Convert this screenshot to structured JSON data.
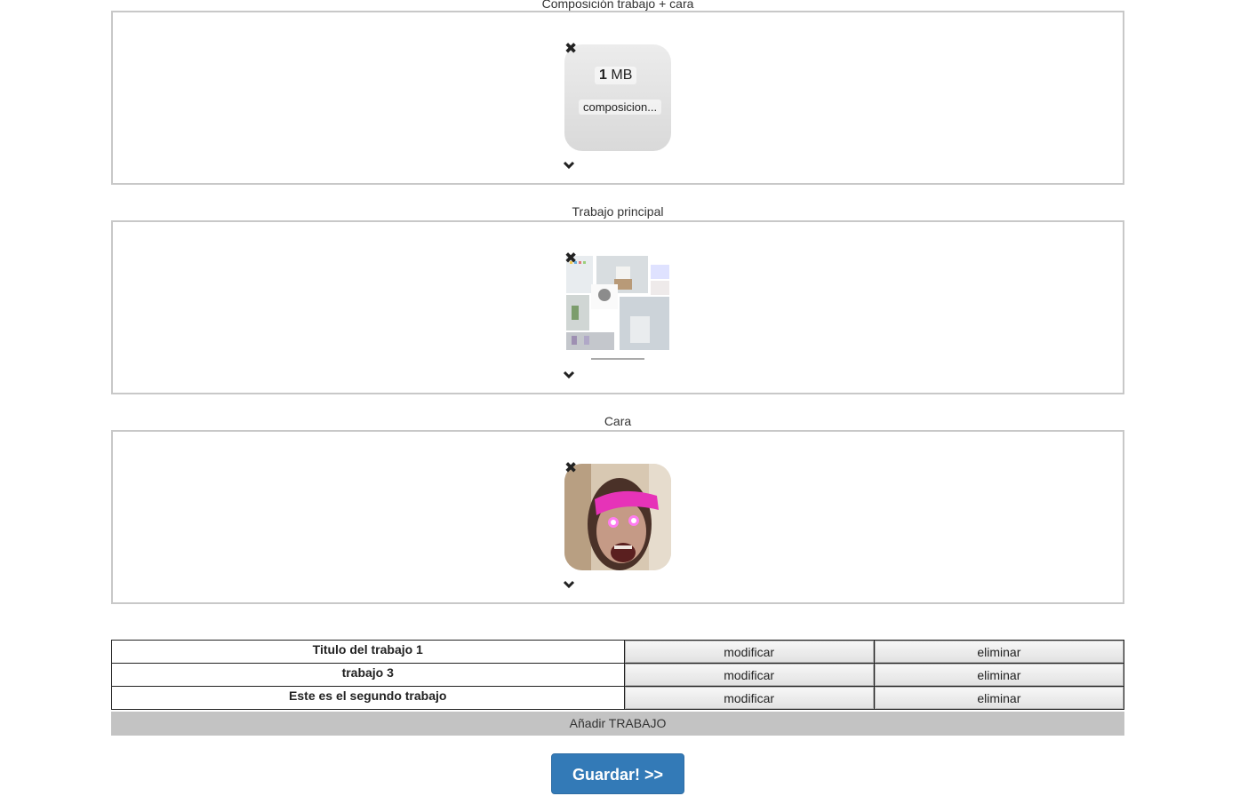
{
  "sections": [
    {
      "label": "Composición trabajo + cara",
      "file_size_value": "1",
      "file_size_unit": "MB",
      "file_name": "composicion..."
    },
    {
      "label": "Trabajo principal"
    },
    {
      "label": "Cara"
    }
  ],
  "works_table": {
    "rows": [
      {
        "title": "Titulo del trabajo 1",
        "modify_label": "modificar",
        "delete_label": "eliminar"
      },
      {
        "title": "trabajo 3",
        "modify_label": "modificar",
        "delete_label": "eliminar"
      },
      {
        "title": "Este es el segundo trabajo",
        "modify_label": "modificar",
        "delete_label": "eliminar"
      }
    ]
  },
  "add_work_label": "Añadir TRABAJO",
  "save_label": "Guardar! >>",
  "colors": {
    "save_button": "#337ab7",
    "add_row": "#c3c3c3",
    "dropzone_border": "#c8c8c8"
  },
  "icons": [
    "remove-icon",
    "chevron-down-icon"
  ]
}
